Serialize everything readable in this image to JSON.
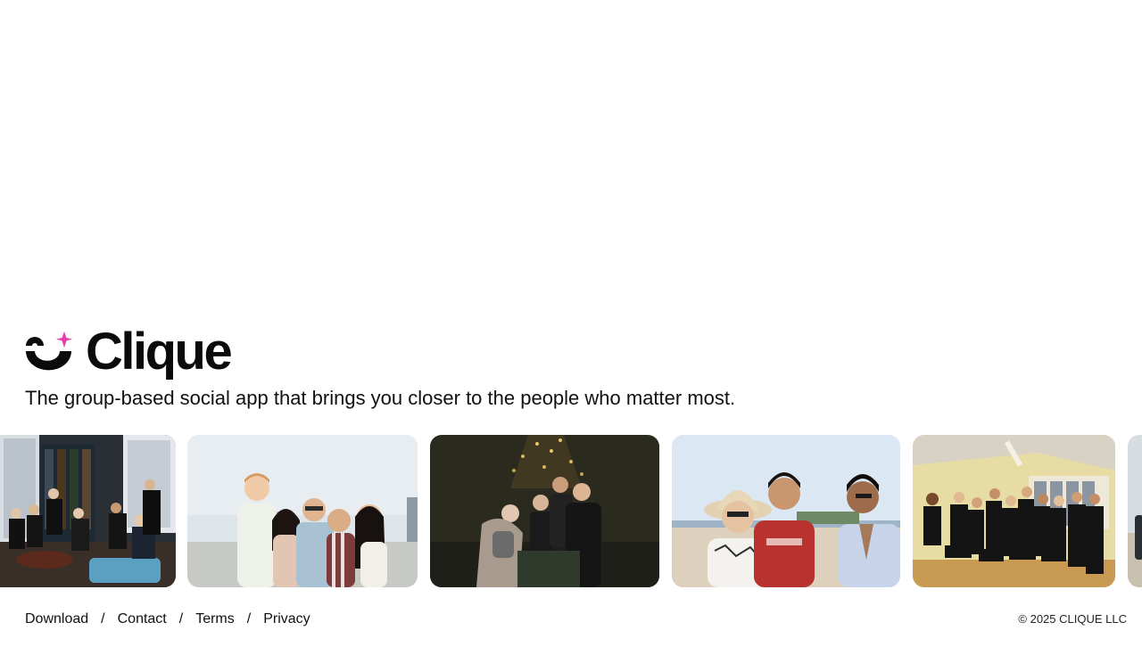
{
  "brand": {
    "name": "Clique",
    "logo_icon": "smile-sparkle-icon",
    "accent_color": "#e83fa8"
  },
  "hero": {
    "tagline": "The group-based social app that brings you closer to the people who matter most."
  },
  "gallery": {
    "photos": [
      {
        "name": "photo-group-living-room",
        "scene": "group-in-suits-indoor"
      },
      {
        "name": "photo-friends-rooftop",
        "scene": "friends-outdoor-skyline"
      },
      {
        "name": "photo-night-eiffel",
        "scene": "friends-night-tower"
      },
      {
        "name": "photo-beach-trio",
        "scene": "three-friends-beach"
      },
      {
        "name": "photo-group-black-outfits",
        "scene": "large-group-indoor"
      },
      {
        "name": "photo-partial-edge",
        "scene": "cropped-photo"
      }
    ]
  },
  "footer": {
    "links": [
      "Download",
      "Contact",
      "Terms",
      "Privacy"
    ],
    "separator": "/",
    "copyright": "© 2025 CLIQUE LLC"
  }
}
